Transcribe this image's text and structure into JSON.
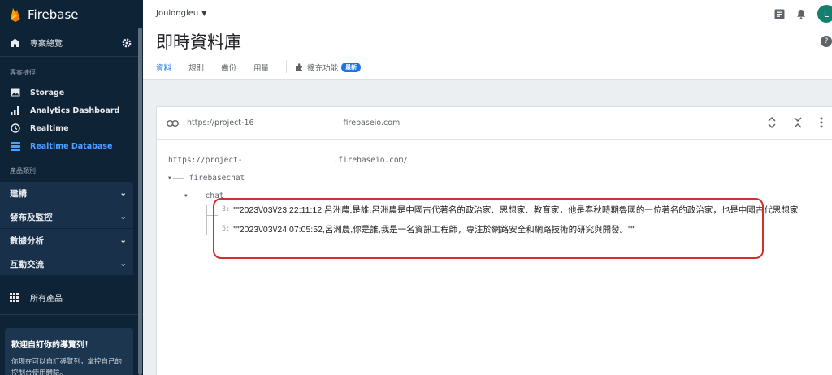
{
  "sidebar": {
    "brand": "Firebase",
    "overview": "專案總覽",
    "shortcuts_title": "專案捷徑",
    "shortcuts": [
      {
        "label": "Storage",
        "icon": "image-icon"
      },
      {
        "label": "Analytics Dashboard",
        "icon": "bar-chart-icon"
      },
      {
        "label": "Realtime",
        "icon": "clock-icon"
      },
      {
        "label": "Realtime Database",
        "icon": "database-icon"
      }
    ],
    "categories_title": "產品類別",
    "groups": [
      "建構",
      "發布及監控",
      "數據分析",
      "互動交流"
    ],
    "all_products": "所有產品",
    "card": {
      "title": "歡迎自訂你的導覽列！",
      "desc": "你現在可以自訂導覽列，掌控自己的控制台使用體驗。"
    }
  },
  "header": {
    "project": "Joulongleu",
    "avatar": "L",
    "title": "即時資料庫"
  },
  "tabs": [
    {
      "label": "資料",
      "active": true
    },
    {
      "label": "規則",
      "active": false
    },
    {
      "label": "備份",
      "active": false
    },
    {
      "label": "用量",
      "active": false
    }
  ],
  "extensions": {
    "label": "擴充功能",
    "badge": "最新"
  },
  "database": {
    "url_prefix": "https://project-16",
    "url_suffix": "firebaseio.com",
    "root": "https://project-",
    "root_suffix": ".firebaseio.com/",
    "node": "firebasechat",
    "child": "chat",
    "entries": [
      {
        "key": "3:",
        "value": "\"\"2023\\/03\\/23 22:11:12,呂洲農,是誰,呂洲農是中國古代著名的政治家、思想家、教育家，他是春秋時期魯國的一位著名的政治家，也是中國古代思想家"
      },
      {
        "key": "5:",
        "value": "\"\"2023\\/03\\/24 07:05:52,呂洲農,你是誰,我是一名資訊工程師，專注於網路安全和網路技術的研究與開發。\"\""
      }
    ]
  },
  "colors": {
    "accent": "#1a73e8",
    "sidebar": "#0f2337",
    "highlight": "#d32f2f"
  }
}
